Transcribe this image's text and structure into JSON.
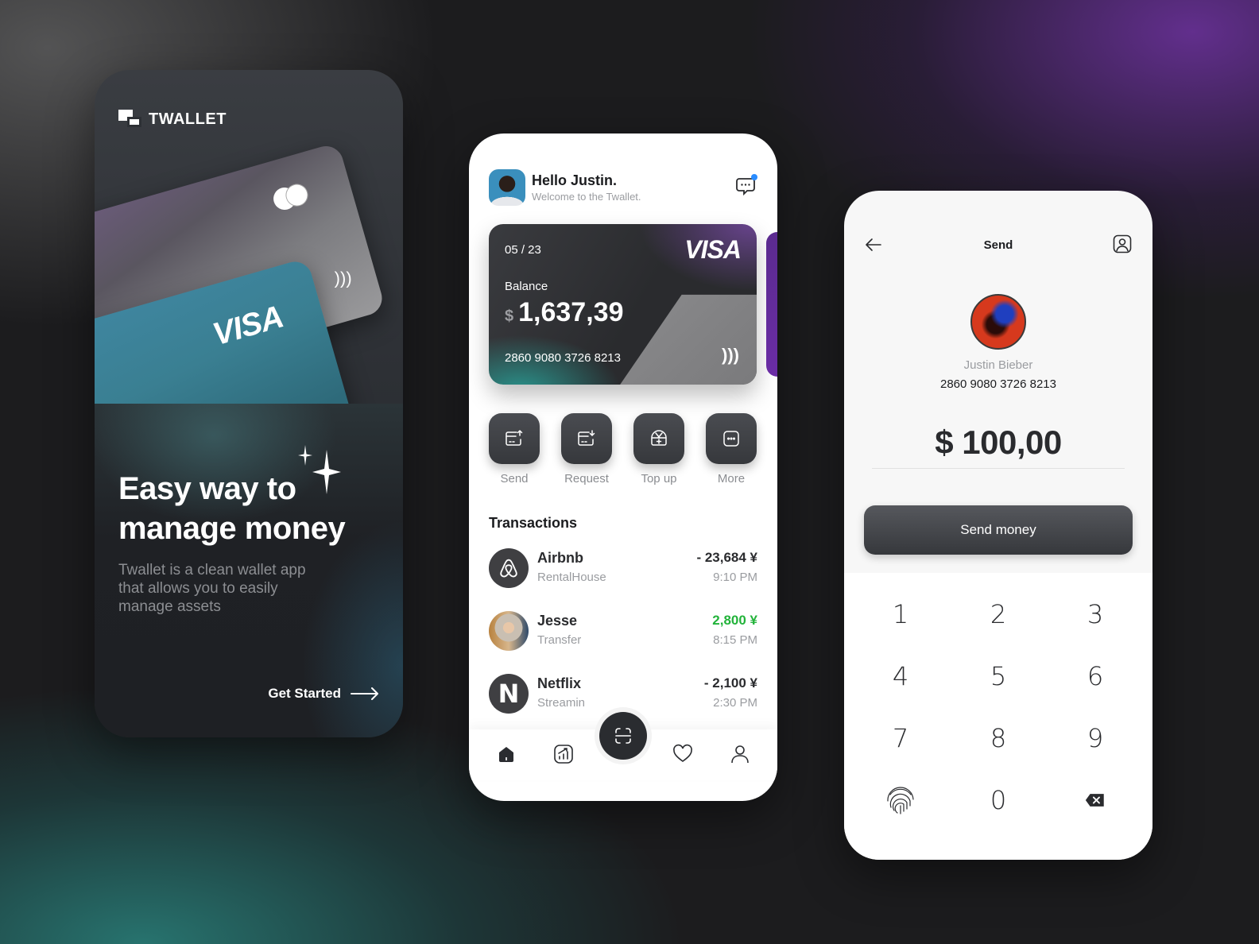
{
  "onboarding": {
    "brand": "TWALLET",
    "card_back_brand": "mastercard",
    "card_front_brand": "VISA",
    "headline_line1": "Easy way to",
    "headline_line2": "manage money",
    "description": "Twallet is a clean wallet app that allows you to easily manage assets",
    "cta_label": "Get Started",
    "icons": [
      "twallet-logo-icon",
      "mastercard-logo-icon",
      "nfc-icon",
      "sparkle-icon",
      "arrow-right-icon"
    ]
  },
  "home": {
    "greeting": "Hello Justin.",
    "subtitle": "Welcome to the Twallet.",
    "notification_dot_color": "#2a8cff",
    "card": {
      "expiry": "05 / 23",
      "brand": "VISA",
      "balance_label": "Balance",
      "currency": "$",
      "balance": "1,637,39",
      "number": "2860 9080 3726 8213",
      "nfc_symbol": ")))"
    },
    "actions": [
      {
        "label": "Send",
        "icon": "card-send-icon"
      },
      {
        "label": "Request",
        "icon": "card-request-icon"
      },
      {
        "label": "Top up",
        "icon": "wallet-add-icon"
      },
      {
        "label": "More",
        "icon": "more-icon"
      }
    ],
    "transactions_title": "Transactions",
    "transactions": [
      {
        "name": "Airbnb",
        "category": "RentalHouse",
        "amount": "- 23,684 ¥",
        "time": "9:10 PM",
        "type": "debit",
        "icon": "airbnb-logo-icon"
      },
      {
        "name": "Jesse",
        "category": "Transfer",
        "amount": "2,800 ¥",
        "time": "8:15 PM",
        "type": "credit",
        "icon": "avatar"
      },
      {
        "name": "Netflix",
        "category": "Streamin",
        "amount": "- 2,100 ¥",
        "time": "2:30 PM",
        "type": "debit",
        "icon": "netflix-logo-icon",
        "glyph": "N"
      }
    ],
    "nav": [
      "home",
      "statistics",
      "scan",
      "favorites",
      "profile"
    ],
    "colors": {
      "credit": "#22b33a",
      "text": "#2a2b2e",
      "muted": "#9a9ca0"
    }
  },
  "send": {
    "title": "Send",
    "recipient_name": "Justin Bieber",
    "recipient_account": "2860 9080 3726 8213",
    "amount": "$ 100,00",
    "button_label": "Send money",
    "keypad": [
      "1",
      "2",
      "3",
      "4",
      "5",
      "6",
      "7",
      "8",
      "9",
      "fingerprint",
      "0",
      "backspace"
    ]
  }
}
